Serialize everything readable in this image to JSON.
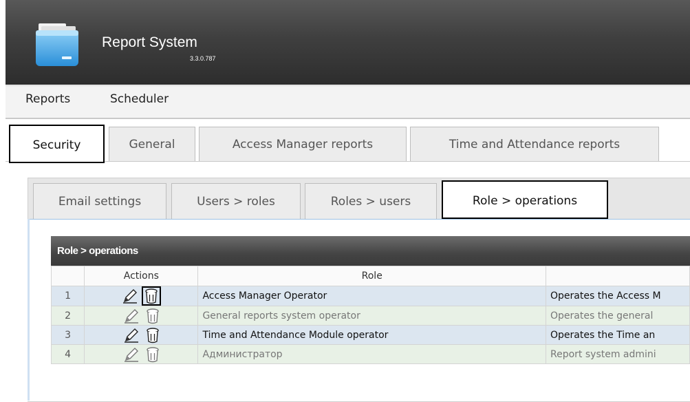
{
  "app": {
    "title": "Report System",
    "version": "3.3.0.787"
  },
  "menu": [
    {
      "label": "Reports"
    },
    {
      "label": "Scheduler"
    }
  ],
  "tabs": [
    {
      "label": "Security",
      "active": true
    },
    {
      "label": "General"
    },
    {
      "label": "Access Manager reports"
    },
    {
      "label": "Time and Attendance reports"
    }
  ],
  "subtabs": [
    {
      "label": "Email settings"
    },
    {
      "label": "Users > roles"
    },
    {
      "label": "Roles > users"
    },
    {
      "label": "Role > operations",
      "active": true
    }
  ],
  "grid": {
    "title": "Role > operations",
    "columns": [
      "",
      "Actions",
      "Role",
      ""
    ],
    "rows": [
      {
        "num": "1",
        "role": "Access Manager Operator",
        "desc": "Operates the Access M"
      },
      {
        "num": "2",
        "role": "General reports system operator",
        "desc": "Operates the general"
      },
      {
        "num": "3",
        "role": "Time and Attendance Module operator",
        "desc": "Operates the Time an"
      },
      {
        "num": "4",
        "role": "Администратор",
        "desc": "Report system admini"
      }
    ]
  },
  "icons": {
    "logo": "folder-icon",
    "edit": "pencil-icon",
    "delete": "trash-icon"
  },
  "colors": {
    "header_bg": "#3f3f3f",
    "row_blue": "#dce6f0",
    "row_green": "#e8f1e6",
    "grid_header": "#4a4a4a"
  }
}
